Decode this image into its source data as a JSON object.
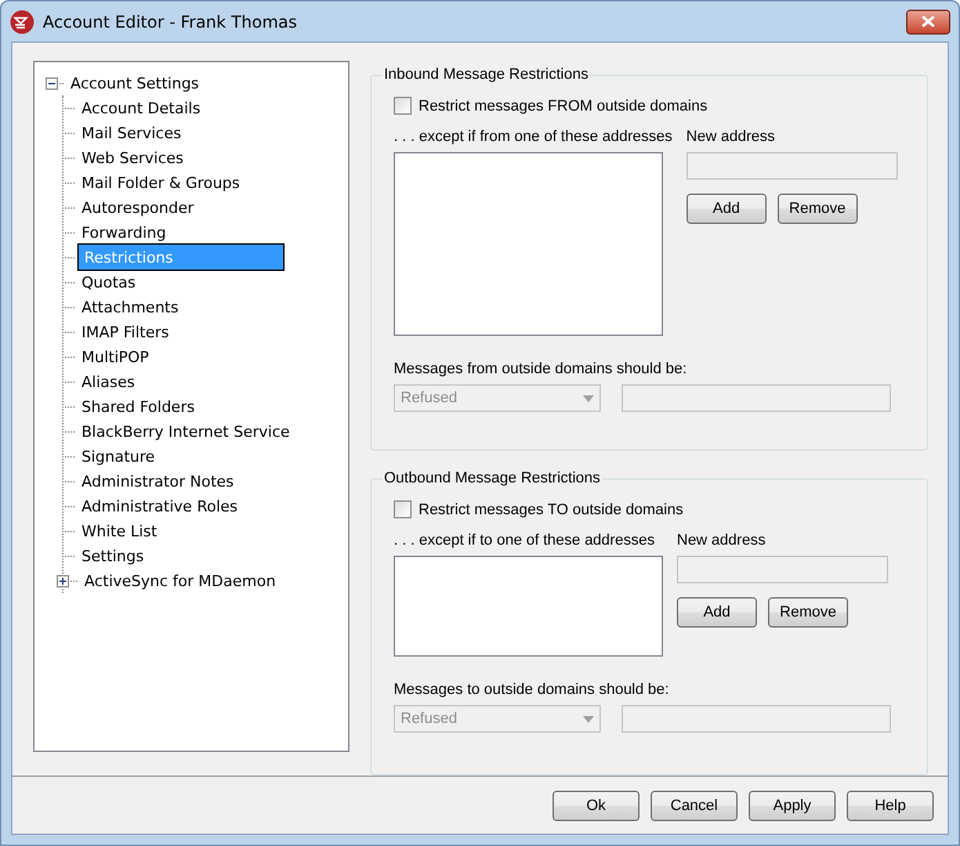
{
  "window": {
    "title": "Account Editor - Frank Thomas"
  },
  "tree": {
    "label": "Account Settings",
    "expanded": true,
    "children": [
      {
        "label": "Account Details",
        "selected": false
      },
      {
        "label": "Mail Services",
        "selected": false
      },
      {
        "label": "Web Services",
        "selected": false
      },
      {
        "label": "Mail Folder & Groups",
        "selected": false
      },
      {
        "label": "Autoresponder",
        "selected": false
      },
      {
        "label": "Forwarding",
        "selected": false
      },
      {
        "label": "Restrictions",
        "selected": true
      },
      {
        "label": "Quotas",
        "selected": false
      },
      {
        "label": "Attachments",
        "selected": false
      },
      {
        "label": "IMAP Filters",
        "selected": false
      },
      {
        "label": "MultiPOP",
        "selected": false
      },
      {
        "label": "Aliases",
        "selected": false
      },
      {
        "label": "Shared Folders",
        "selected": false
      },
      {
        "label": "BlackBerry Internet Service",
        "selected": false
      },
      {
        "label": "Signature",
        "selected": false
      },
      {
        "label": "Administrator Notes",
        "selected": false
      },
      {
        "label": "Administrative Roles",
        "selected": false
      },
      {
        "label": "White List",
        "selected": false
      },
      {
        "label": "Settings",
        "selected": false
      },
      {
        "label": "ActiveSync for MDaemon",
        "selected": false,
        "expanded": false
      }
    ]
  },
  "sections": [
    {
      "title": "Inbound Message Restrictions",
      "checkbox": {
        "label": "Restrict messages FROM outside domains",
        "checked": false
      },
      "list_label": ". . . except if from one of these addresses",
      "new_address": {
        "label": "New address",
        "disabled": true
      },
      "buttons": [
        "Add",
        "Remove"
      ],
      "action_label": "Messages from outside domains should be:",
      "action_select": {
        "value": "Refused",
        "disabled": true
      },
      "action_field": {
        "disabled": true
      }
    },
    {
      "title": "Outbound Message Restrictions",
      "checkbox": {
        "label": "Restrict messages TO outside domains",
        "checked": false
      },
      "list_label": ". . . except if to one of these addresses",
      "new_address": {
        "label": "New address",
        "disabled": true
      },
      "buttons": [
        "Add",
        "Remove"
      ],
      "action_label": "Messages to outside domains should be:",
      "action_select": {
        "value": "Refused",
        "disabled": true
      },
      "action_field": {
        "disabled": true
      }
    }
  ],
  "buttons": [
    "Ok",
    "Cancel",
    "Apply",
    "Help"
  ]
}
